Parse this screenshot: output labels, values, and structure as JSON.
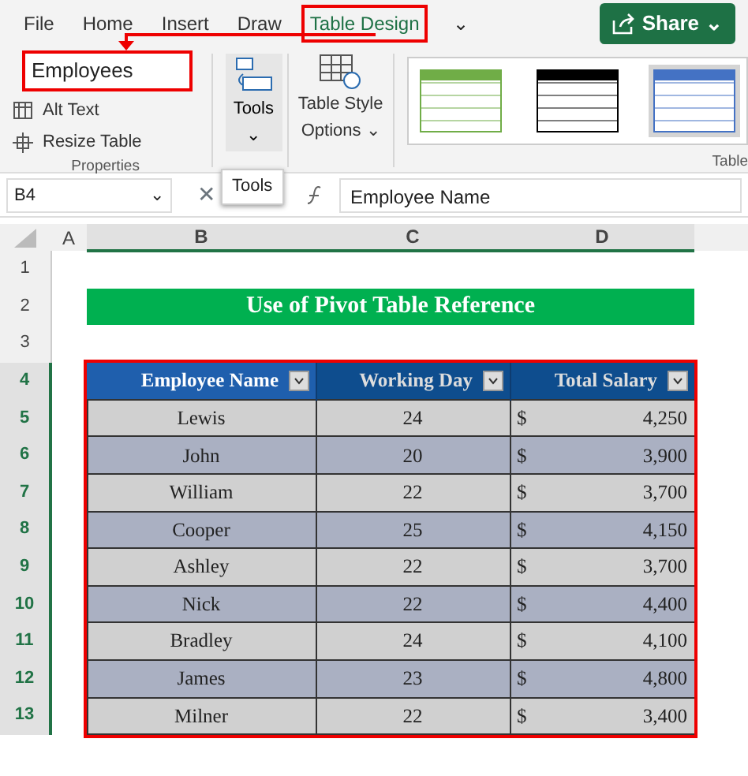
{
  "ribbon_tabs": [
    {
      "label": "File",
      "selected": false
    },
    {
      "label": "Home",
      "selected": false
    },
    {
      "label": "Insert",
      "selected": false
    },
    {
      "label": "Draw",
      "selected": false
    },
    {
      "label": "Table Design",
      "selected": true
    }
  ],
  "more_tabs": "⌄",
  "share_button": {
    "label": "Share",
    "caret": "⌄"
  },
  "properties": {
    "table_name": "Employees",
    "items": [
      "Alt Text",
      "Resize Table"
    ],
    "group_label": "Properties"
  },
  "tools": {
    "label": "Tools",
    "caret": "⌄",
    "tooltip": "Tools"
  },
  "table_style_options": {
    "label_1": "Table Style",
    "label_2": "Options",
    "caret": "⌄"
  },
  "styles": [
    {
      "color": "#70ad47",
      "selected": false
    },
    {
      "color": "#000000",
      "selected": false
    },
    {
      "color": "#4472c4",
      "selected": true
    }
  ],
  "styles_group_label": "Table",
  "formula_bar": {
    "cell": "B4",
    "caret": "⌄",
    "cancel": "✕",
    "formula": "Employee Name"
  },
  "columns": [
    "A",
    "B",
    "C",
    "D"
  ],
  "row_numbers": [
    "1",
    "2",
    "3",
    "4",
    "5",
    "6",
    "7",
    "8",
    "9",
    "10",
    "11",
    "12",
    "13"
  ],
  "title": "Use of Pivot Table Reference",
  "table": {
    "columns": [
      "Employee Name",
      "Working Day",
      "Total Salary"
    ],
    "rows": [
      {
        "employee_name": "Lewis",
        "working_day": "24",
        "currency": "$",
        "total_salary": "4,250"
      },
      {
        "employee_name": "John",
        "working_day": "20",
        "currency": "$",
        "total_salary": "3,900"
      },
      {
        "employee_name": "William",
        "working_day": "22",
        "currency": "$",
        "total_salary": "3,700"
      },
      {
        "employee_name": "Cooper",
        "working_day": "25",
        "currency": "$",
        "total_salary": "4,150"
      },
      {
        "employee_name": "Ashley",
        "working_day": "22",
        "currency": "$",
        "total_salary": "3,700"
      },
      {
        "employee_name": "Nick",
        "working_day": "22",
        "currency": "$",
        "total_salary": "4,400"
      },
      {
        "employee_name": "Bradley",
        "working_day": "24",
        "currency": "$",
        "total_salary": "4,100"
      },
      {
        "employee_name": "James",
        "working_day": "23",
        "currency": "$",
        "total_salary": "4,800"
      },
      {
        "employee_name": "Milner",
        "working_day": "22",
        "currency": "$",
        "total_salary": "3,400"
      }
    ]
  }
}
